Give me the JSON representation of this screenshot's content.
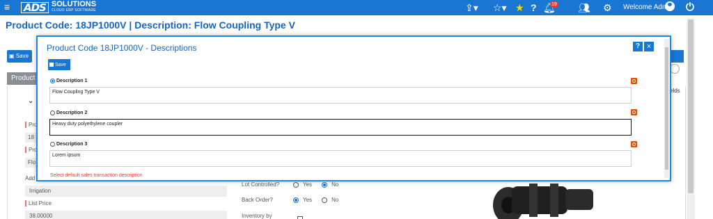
{
  "topbar": {
    "menu_icon": "hamburger-icon",
    "logo_mark": "ADS",
    "logo_name": "SOLUTIONS",
    "logo_tagline": "CLOUD ERP SOFTWARE",
    "notifications_count": "19",
    "welcome_text": "Welcome Admin"
  },
  "page": {
    "title": "Product Code:  18JP1000V | Description: Flow Coupling Type V",
    "save_label": "Save",
    "tab_label": "Product",
    "fields_label": "elds",
    "stub_pro1": "Pro",
    "stub_18": "18",
    "stub_pro2": "Pro",
    "stub_flo": "Flo",
    "additional_label": "Add",
    "irrigation_value": "Irrigation",
    "list_price_label": "List Price",
    "list_price_value": "38.00000",
    "lot_controlled_label": "Lot Controlled?",
    "back_order_label": "Back Order?",
    "inventory_location_label": "Inventory by Location?",
    "yes_label": "Yes",
    "no_label": "No"
  },
  "modal": {
    "title": "Product Code 18JP1000V - Descriptions",
    "help_label": "?",
    "close_label": "×",
    "save_label": "Save",
    "descriptions": [
      {
        "label": "Description 1",
        "value": "Flow Coupling Type V",
        "selected": true
      },
      {
        "label": "Description 2",
        "value": "Heavy duty polyethylene coupler",
        "selected": false
      },
      {
        "label": "Description 3",
        "value": "Lorem ipsum",
        "selected": false
      }
    ],
    "note": "Select default sales transaction description"
  },
  "colors": {
    "brand_blue": "#1976d2",
    "title_blue": "#1565c0",
    "alert_red": "#e53935",
    "reset_orange": "#e65100"
  }
}
